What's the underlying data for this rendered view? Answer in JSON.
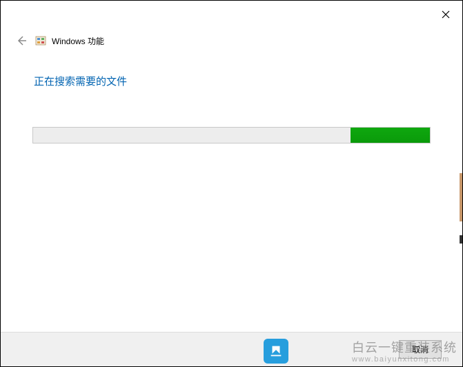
{
  "window": {
    "title": "Windows 功能"
  },
  "status": {
    "message": "正在搜索需要的文件"
  },
  "progress": {
    "percent": 20
  },
  "footer": {
    "cancel_label": "取消"
  },
  "watermark": {
    "main_text": "白云一键重装系统",
    "sub_text": "www.baiyunxitong.com"
  }
}
